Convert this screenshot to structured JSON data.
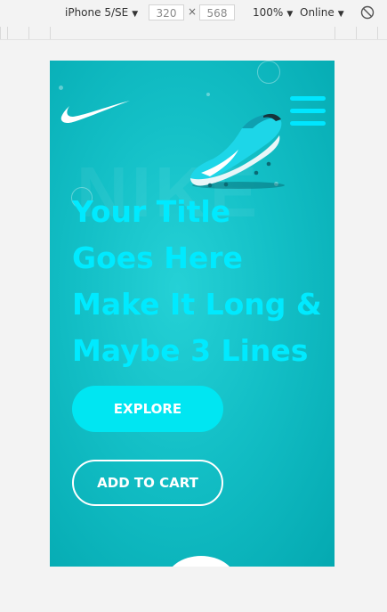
{
  "devtools": {
    "device": "iPhone 5/SE",
    "width": "320",
    "times": "×",
    "height": "568",
    "zoom": "100%",
    "network": "Online"
  },
  "page": {
    "title_lines": [
      "Your Title",
      "Goes Here",
      "Make It Long &",
      "Maybe 3 Lines"
    ],
    "explore_label": "EXPLORE",
    "cart_label": "ADD TO CART",
    "background_word": "NIKE"
  },
  "colors": {
    "accent": "#00e6ff",
    "background": "#13bfc6"
  }
}
